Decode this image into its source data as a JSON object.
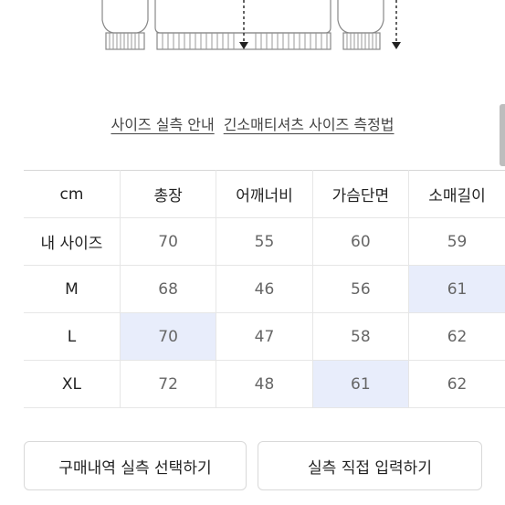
{
  "links": {
    "size_guide": "사이즈 실측 안내",
    "measure_method": "긴소매티셔츠 사이즈 측정법"
  },
  "table": {
    "headers": [
      "cm",
      "총장",
      "어깨너비",
      "가슴단면",
      "소매길이"
    ],
    "rows": [
      {
        "label": "내 사이즈",
        "values": [
          "70",
          "55",
          "60",
          "59"
        ]
      },
      {
        "label": "M",
        "values": [
          "68",
          "46",
          "56",
          "61"
        ]
      },
      {
        "label": "L",
        "values": [
          "70",
          "47",
          "58",
          "62"
        ]
      },
      {
        "label": "XL",
        "values": [
          "72",
          "48",
          "61",
          "62"
        ]
      }
    ],
    "highlight_color": "#e8edfb"
  },
  "buttons": {
    "history": "구매내역 실측 선택하기",
    "manual": "실측 직접 입력하기"
  }
}
